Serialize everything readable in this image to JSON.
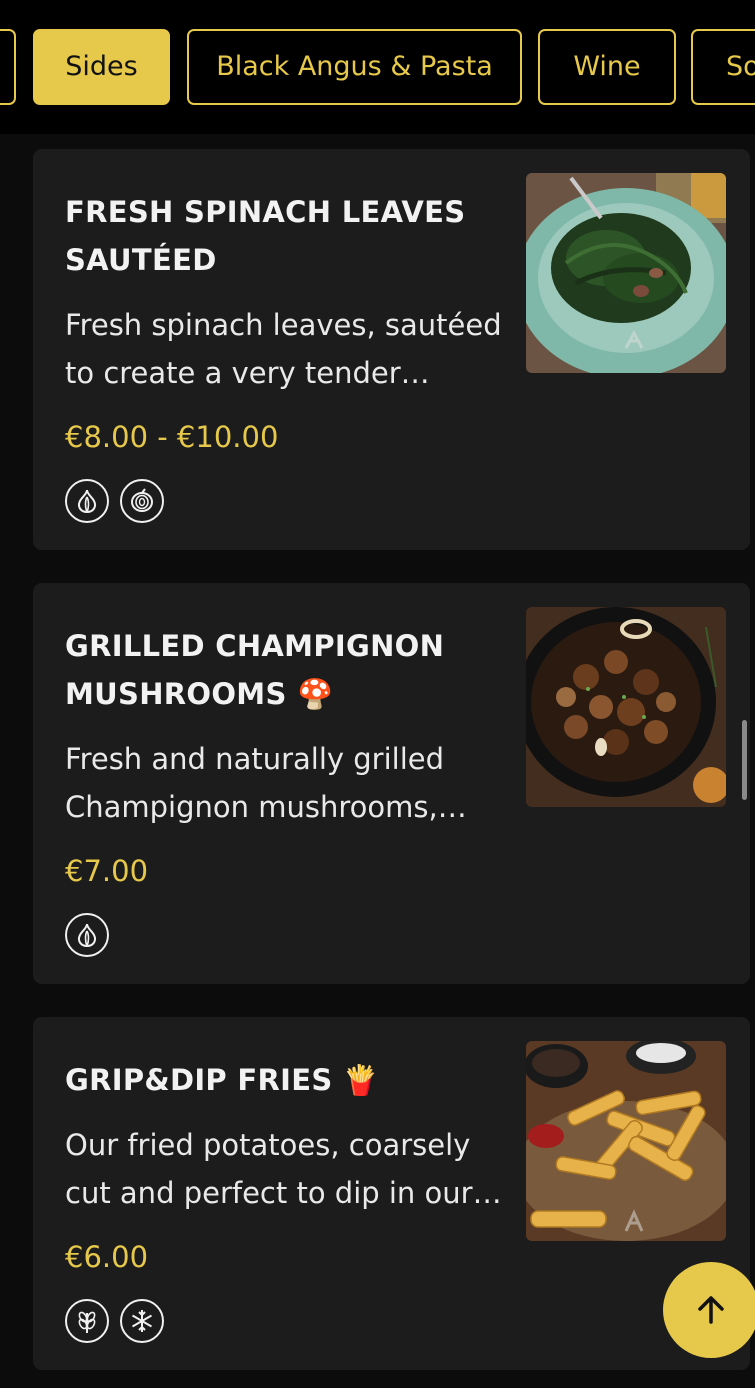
{
  "tabs": [
    {
      "label": ""
    },
    {
      "label": "Sides"
    },
    {
      "label": "Black Angus & Pasta"
    },
    {
      "label": "Wine"
    },
    {
      "label": "So"
    }
  ],
  "active_tab": "Sides",
  "items": [
    {
      "title": "FRESH SPINACH LEAVES SAUTÉED",
      "description": "Fresh spinach leaves, sautéed to create a very tender…",
      "price": "€8.00 - €10.00",
      "allergens": [
        "garlic-icon",
        "onion-icon"
      ],
      "image": "spinach-dish-photo"
    },
    {
      "title": "GRILLED CHAMPIGNON MUSHROOMS 🍄",
      "description": "Fresh and naturally grilled Champignon mushrooms,…",
      "price": "€7.00",
      "allergens": [
        "garlic-icon"
      ],
      "image": "mushrooms-pan-photo"
    },
    {
      "title": "GRIP&DIP FRIES 🍟",
      "description": "Our fried potatoes, coarsely cut and perfect to dip in our…",
      "price": "€6.00",
      "allergens": [
        "gluten-wheat-icon",
        "frozen-snowflake-icon"
      ],
      "image": "fries-board-photo"
    }
  ],
  "colors": {
    "accent": "#e6c84a",
    "background": "#0c0c0c",
    "card": "#1c1c1c",
    "text": "#f2f2f2"
  },
  "fab_icon": "arrow-up-icon"
}
